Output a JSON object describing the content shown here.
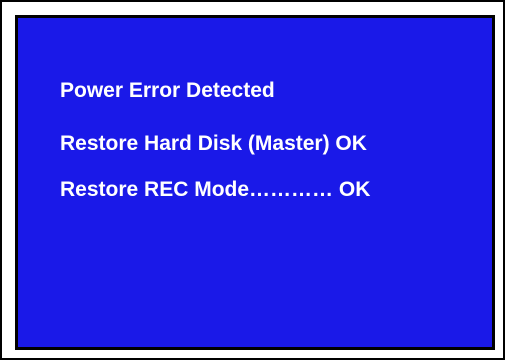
{
  "screen": {
    "background_color": "#1a19e8",
    "text_color": "#ffffff",
    "lines": [
      "Power Error Detected",
      "Restore Hard Disk (Master) OK",
      "Restore REC Mode………… OK"
    ]
  }
}
